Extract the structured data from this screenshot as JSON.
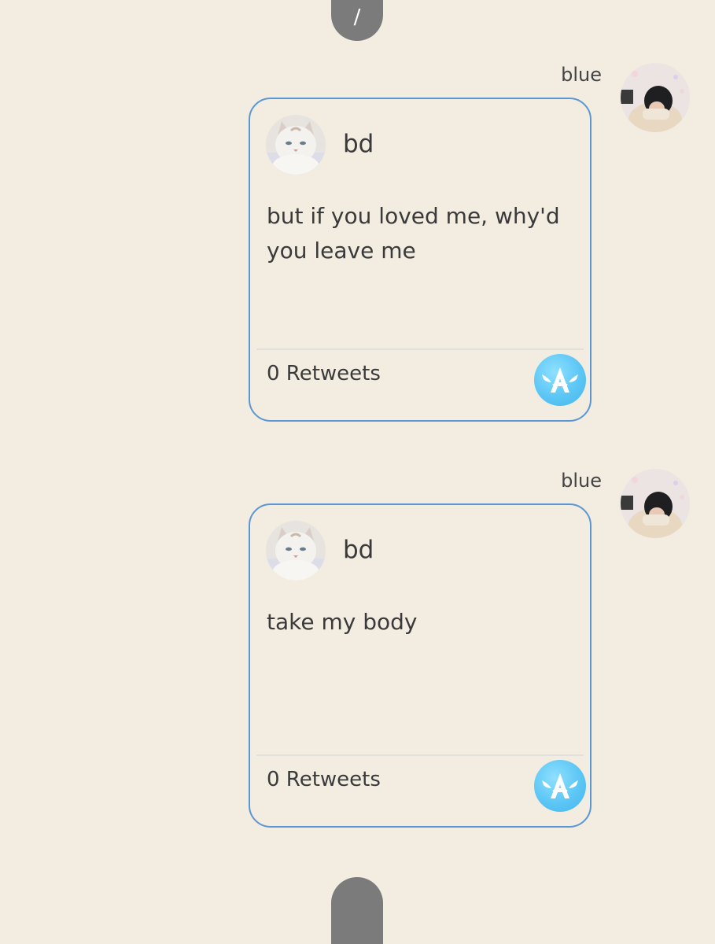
{
  "top_handle": {
    "label": "/"
  },
  "messages": [
    {
      "sender": "blue",
      "sender_avatar_icon": "person-photo-avatar",
      "tweet": {
        "author": "bd",
        "author_avatar_icon": "white-cat-avatar",
        "text": "but if you loved me, why'd you leave me",
        "retweets": "0 Retweets",
        "badge_icon": "winged-a-app-icon"
      }
    },
    {
      "sender": "blue",
      "sender_avatar_icon": "person-photo-avatar",
      "tweet": {
        "author": "bd",
        "author_avatar_icon": "white-cat-avatar",
        "text": "take my body",
        "retweets": "0 Retweets",
        "badge_icon": "winged-a-app-icon"
      }
    }
  ],
  "colors": {
    "background": "#f2ece1",
    "card_border": "#5a97d4",
    "handle": "#7b7b7b",
    "badge": "#5cc6f5"
  }
}
